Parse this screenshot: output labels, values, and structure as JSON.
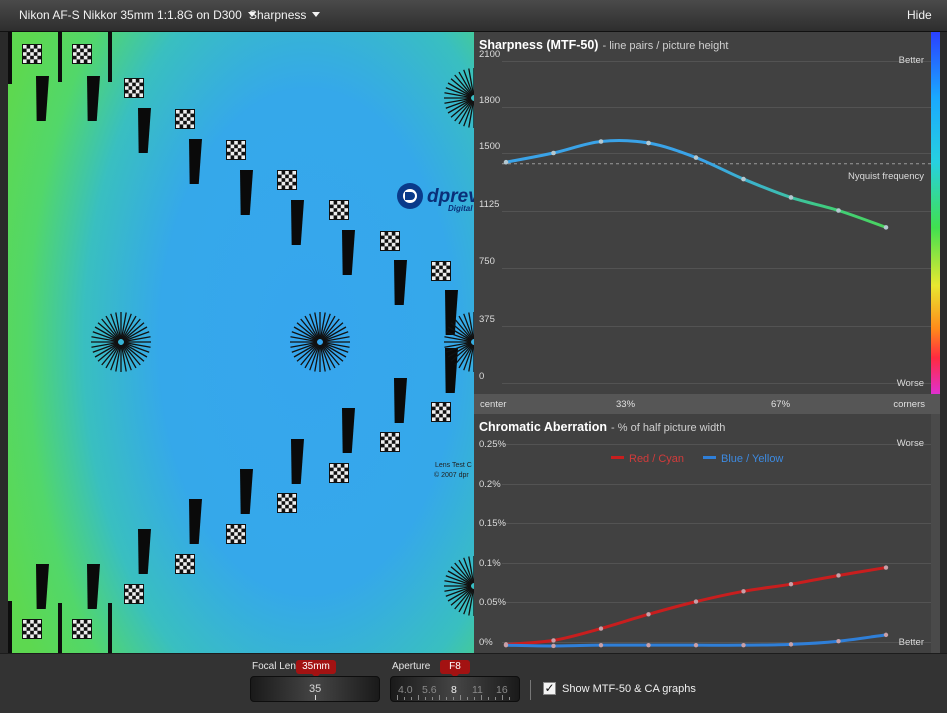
{
  "topbar": {
    "lens_select": "Nikon AF-S Nikkor 35mm 1:1.8G on D300",
    "mode_select": "Sharpness",
    "hide_label": "Hide"
  },
  "test_chart": {
    "logo_text": "dprev",
    "logo_sub": "Digital",
    "caption_line1": "Lens Test C",
    "caption_line2": "© 2007 dpr"
  },
  "sharpness_panel": {
    "title": "Sharpness (MTF-50)",
    "subtitle": "-  line pairs / picture height",
    "y_ticks": [
      "2100",
      "1800",
      "1500",
      "1125",
      "750",
      "375",
      "0"
    ],
    "better_label": "Better",
    "worse_label": "Worse",
    "nyquist_label": "Nyquist frequency"
  },
  "position_axis": {
    "labels": [
      "center",
      "33%",
      "67%",
      "corners"
    ]
  },
  "ca_panel": {
    "title": "Chromatic Aberration",
    "subtitle": "-  % of half picture width",
    "y_ticks": [
      "0.25%",
      "0.2%",
      "0.15%",
      "0.1%",
      "0.05%",
      "0%"
    ],
    "worse_label": "Worse",
    "better_label": "Better",
    "legend": [
      {
        "name": "Red / Cyan",
        "color": "#c81e1e"
      },
      {
        "name": "Blue / Yellow",
        "color": "#2f7fd8"
      }
    ]
  },
  "chart_data": [
    {
      "type": "line",
      "title": "Sharpness (MTF-50)",
      "ylabel": "line pairs / picture height",
      "xlabel": "",
      "x_labels": [
        "center",
        "33%",
        "67%",
        "corners"
      ],
      "x": [
        0,
        12.5,
        25,
        37.5,
        50,
        62.5,
        75,
        87.5,
        100
      ],
      "ylim": [
        0,
        2100
      ],
      "reference_lines": [
        {
          "label": "Nyquist frequency",
          "y": 1430
        }
      ],
      "series": [
        {
          "values": [
            1440,
            1500,
            1575,
            1565,
            1470,
            1330,
            1210,
            1125,
            1015
          ]
        }
      ]
    },
    {
      "type": "line",
      "title": "Chromatic Aberration",
      "ylabel": "% of half picture width",
      "xlabel": "",
      "x_labels": [
        "center",
        "33%",
        "67%",
        "corners"
      ],
      "x": [
        0,
        12.5,
        25,
        37.5,
        50,
        62.5,
        75,
        87.5,
        100
      ],
      "ylim": [
        0,
        0.25
      ],
      "series": [
        {
          "name": "Red / Cyan",
          "color": "#c81e1e",
          "values": [
            -0.003,
            0.002,
            0.017,
            0.035,
            0.051,
            0.064,
            0.073,
            0.084,
            0.094
          ]
        },
        {
          "name": "Blue / Yellow",
          "color": "#2f7fd8",
          "values": [
            -0.004,
            -0.005,
            -0.004,
            -0.004,
            -0.004,
            -0.004,
            -0.003,
            0.001,
            0.009
          ]
        }
      ]
    }
  ],
  "controls": {
    "focal_label": "Focal Len.",
    "focal_badge": "35mm",
    "focal_value": "35",
    "aperture_label": "Aperture",
    "aperture_badge": "F8",
    "aperture_values": [
      "4.0",
      "5.6",
      "8",
      "11",
      "16"
    ],
    "aperture_selected": "8",
    "show_graphs_label": "Show MTF-50 & CA graphs",
    "show_graphs_checked": true
  }
}
